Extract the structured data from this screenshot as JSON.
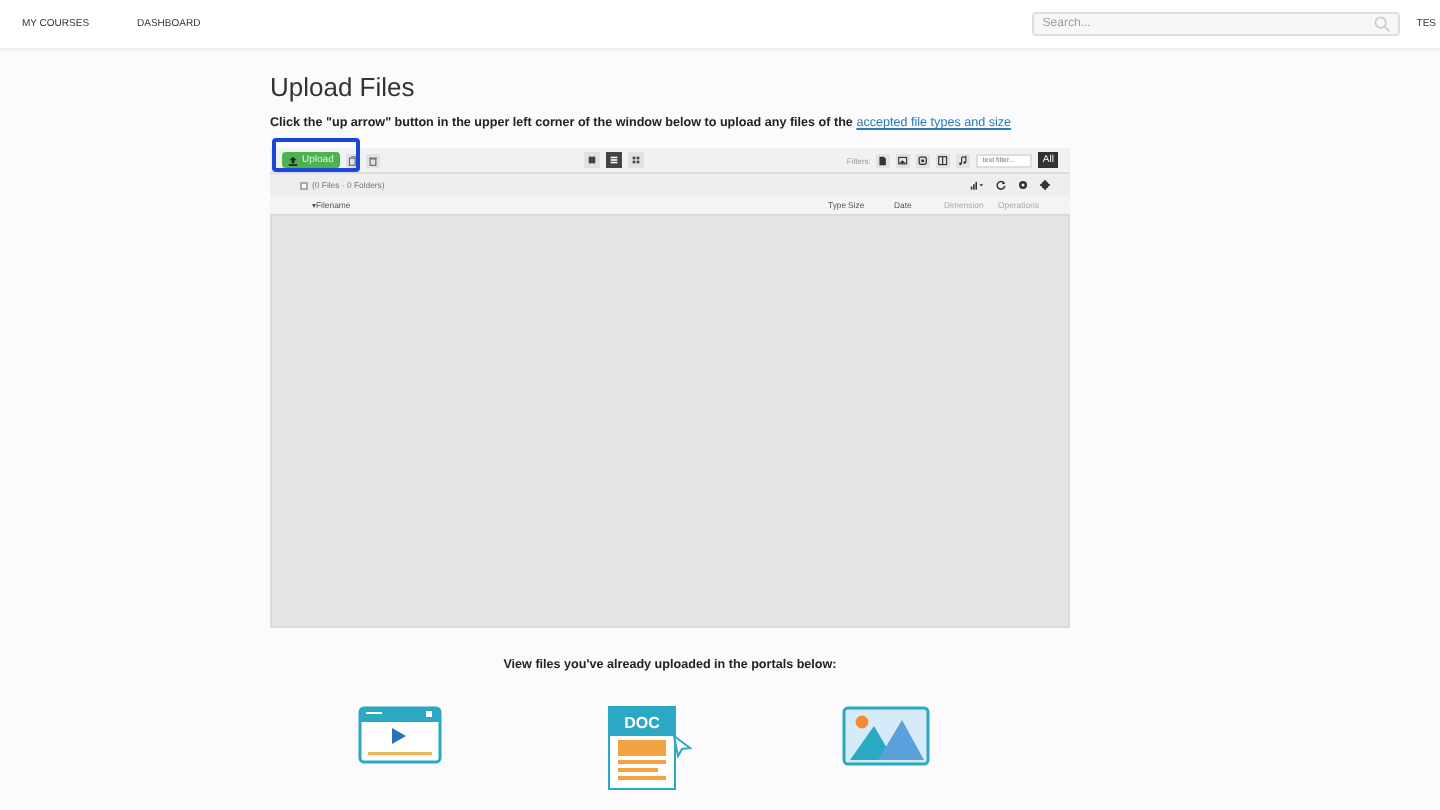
{
  "nav": {
    "items": [
      {
        "label": "MY COURSES"
      },
      {
        "label": "DASHBOARD"
      }
    ],
    "search": {
      "placeholder": "Search..."
    },
    "user": "TES"
  },
  "title": "Upload Files",
  "instruction": {
    "text": "Click the \"up arrow\" button in the upper left corner of the window below to upload any files of the ",
    "link": "accepted file types and size"
  },
  "toolbar": {
    "upload": "Upload",
    "views": [
      {
        "kind": "list",
        "selected": false
      },
      {
        "kind": "detail",
        "selected": true
      },
      {
        "kind": "grid",
        "selected": false
      }
    ],
    "filters_label": "Filters:",
    "filters": [
      {
        "kind": "file"
      },
      {
        "kind": "image"
      },
      {
        "kind": "media"
      },
      {
        "kind": "archive"
      },
      {
        "kind": "music"
      }
    ],
    "filter_placeholder": "text filter...",
    "all": {
      "label": "All",
      "selected": true
    }
  },
  "status": {
    "checked": false,
    "text": "(0 Files · 0 Folders)"
  },
  "columns": [
    {
      "label": "▾Filename",
      "muted": false
    },
    {
      "label": "Type",
      "muted": false
    },
    {
      "label": "Size",
      "muted": false
    },
    {
      "label": "Date",
      "muted": false
    },
    {
      "label": "Dimension",
      "muted": true
    },
    {
      "label": "Operations",
      "muted": true
    }
  ],
  "portals_heading": "View files you've already uploaded in the portals below:",
  "portals": [
    {
      "kind": "video"
    },
    {
      "kind": "doc",
      "badge": "DOC"
    },
    {
      "kind": "image"
    }
  ]
}
